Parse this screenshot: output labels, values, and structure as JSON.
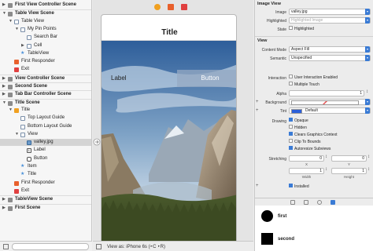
{
  "outline": {
    "rows": [
      {
        "label": "First View Controller Scene",
        "level": 0,
        "expanded": false,
        "kind": "scene"
      },
      {
        "label": "Table View Scene",
        "level": 0,
        "expanded": true,
        "kind": "scene"
      },
      {
        "label": "Table View",
        "level": 1,
        "expanded": true,
        "kind": "tv"
      },
      {
        "label": "My Pin Points",
        "level": 2,
        "expanded": true,
        "kind": "view"
      },
      {
        "label": "Search Bar",
        "level": 3,
        "expanded": null,
        "kind": "view"
      },
      {
        "label": "Cell",
        "level": 3,
        "expanded": false,
        "kind": "view"
      },
      {
        "label": "TableView",
        "level": 2,
        "expanded": null,
        "kind": "item"
      },
      {
        "label": "First Responder",
        "level": 1,
        "expanded": null,
        "kind": "fr"
      },
      {
        "label": "Exit",
        "level": 1,
        "expanded": null,
        "kind": "ex"
      },
      {
        "label": "View Controller Scene",
        "level": 0,
        "expanded": false,
        "kind": "scene"
      },
      {
        "label": "Second Scene",
        "level": 0,
        "expanded": false,
        "kind": "scene"
      },
      {
        "label": "Tab Bar Controller Scene",
        "level": 0,
        "expanded": false,
        "kind": "scene"
      },
      {
        "label": "Title Scene",
        "level": 0,
        "expanded": true,
        "kind": "scene"
      },
      {
        "label": "Title",
        "level": 1,
        "expanded": true,
        "kind": "vc"
      },
      {
        "label": "Top Layout Guide",
        "level": 2,
        "expanded": null,
        "kind": "view"
      },
      {
        "label": "Bottom Layout Guide",
        "level": 2,
        "expanded": null,
        "kind": "view"
      },
      {
        "label": "View",
        "level": 2,
        "expanded": true,
        "kind": "view"
      },
      {
        "label": "valley.jpg",
        "level": 3,
        "expanded": null,
        "kind": "img",
        "selected": true
      },
      {
        "label": "Label",
        "level": 3,
        "expanded": null,
        "kind": "lbl"
      },
      {
        "label": "Button",
        "level": 3,
        "expanded": null,
        "kind": "btn"
      },
      {
        "label": "Item",
        "level": 2,
        "expanded": null,
        "kind": "item"
      },
      {
        "label": "Title",
        "level": 2,
        "expanded": null,
        "kind": "item"
      },
      {
        "label": "First Responder",
        "level": 1,
        "expanded": null,
        "kind": "fr"
      },
      {
        "label": "Exit",
        "level": 1,
        "expanded": null,
        "kind": "ex"
      },
      {
        "label": "TableView Scene",
        "level": 0,
        "expanded": false,
        "kind": "scene"
      },
      {
        "label": "First Scene",
        "level": 0,
        "expanded": false,
        "kind": "scene"
      }
    ]
  },
  "canvas": {
    "nav_title": "Title",
    "label_text": "Label",
    "button_text": "Button",
    "view_as": "View as: iPhone 6s (‣C ‣R)",
    "dock_colors": [
      "#f0a020",
      "#e8602c",
      "#e04040"
    ]
  },
  "inspector": {
    "image_view": {
      "section": "Image View",
      "image_label": "Image",
      "image_value": "valley.jpg",
      "highlighted_label": "Highlighted",
      "highlighted_placeholder": "Highlighted Image",
      "state_label": "State",
      "state_highlighted": "Highlighted"
    },
    "view": {
      "section": "View",
      "content_mode_label": "Content Mode",
      "content_mode_value": "Aspect Fill",
      "semantic_label": "Semantic",
      "semantic_value": "Unspecified",
      "interaction_label": "Interaction",
      "user_interaction": "User Interaction Enabled",
      "multiple_touch": "Multiple Touch",
      "alpha_label": "Alpha",
      "alpha_value": "1",
      "background_label": "Background",
      "tint_label": "Tint",
      "tint_value": "Default",
      "drawing_label": "Drawing",
      "opaque": "Opaque",
      "hidden": "Hidden",
      "clears_context": "Clears Graphics Context",
      "clip_bounds": "Clip To Bounds",
      "autoresize": "Autoresize Subviews",
      "stretching_label": "Stretching",
      "stretch_x": "0",
      "stretch_y": "0",
      "stretch_x_label": "X",
      "stretch_y_label": "Y",
      "stretch_w": "1",
      "stretch_h": "1",
      "width_label": "Width",
      "height_label": "Height",
      "installed": "Installed"
    }
  },
  "library": {
    "items": [
      {
        "name": "first",
        "shape": "circle"
      },
      {
        "name": "second",
        "shape": "square"
      }
    ]
  },
  "colors": {
    "accent": "#3a7bd5",
    "selection": "#d4d4d4",
    "tint_swatch": "#2b5fd9"
  }
}
